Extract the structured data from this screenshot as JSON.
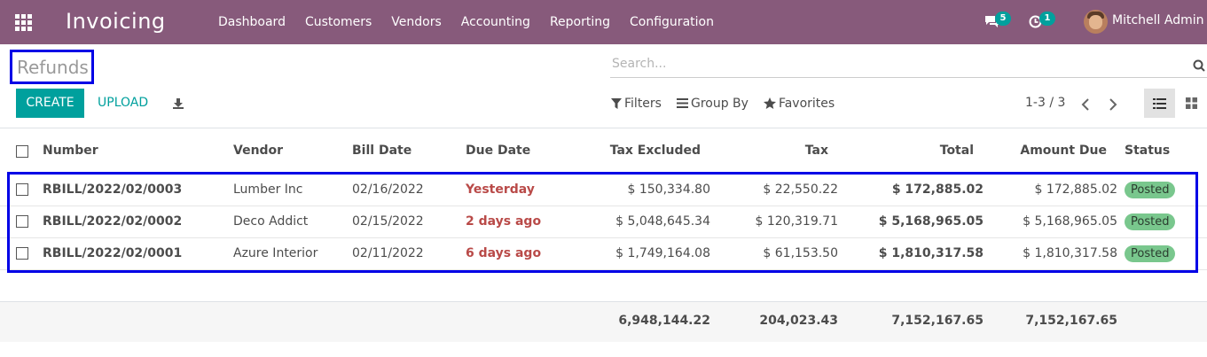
{
  "navbar": {
    "app_title": "Invoicing",
    "menu": [
      "Dashboard",
      "Customers",
      "Vendors",
      "Accounting",
      "Reporting",
      "Configuration"
    ],
    "messages_badge": "5",
    "activities_badge": "1",
    "user_name": "Mitchell Admin",
    "color": "#875a7b"
  },
  "breadcrumb": "Refunds",
  "search": {
    "placeholder": "Search..."
  },
  "toolbar": {
    "create_label": "CREATE",
    "upload_label": "UPLOAD"
  },
  "filters": {
    "filters_label": "Filters",
    "group_by_label": "Group By",
    "favorites_label": "Favorites"
  },
  "pager": "1-3 / 3",
  "table": {
    "columns": [
      "Number",
      "Vendor",
      "Bill Date",
      "Due Date",
      "Tax Excluded",
      "Tax",
      "Total",
      "Amount Due",
      "Status"
    ],
    "rows": [
      {
        "number": "RBILL/2022/02/0003",
        "vendor": "Lumber Inc",
        "bill_date": "02/16/2022",
        "due_date": "Yesterday",
        "tax_excluded": "$ 150,334.80",
        "tax": "$ 22,550.22",
        "total": "$ 172,885.02",
        "amount_due": "$ 172,885.02",
        "status": "Posted"
      },
      {
        "number": "RBILL/2022/02/0002",
        "vendor": "Deco Addict",
        "bill_date": "02/15/2022",
        "due_date": "2 days ago",
        "tax_excluded": "$ 5,048,645.34",
        "tax": "$ 120,319.71",
        "total": "$ 5,168,965.05",
        "amount_due": "$ 5,168,965.05",
        "status": "Posted"
      },
      {
        "number": "RBILL/2022/02/0001",
        "vendor": "Azure Interior",
        "bill_date": "02/11/2022",
        "due_date": "6 days ago",
        "tax_excluded": "$ 1,749,164.08",
        "tax": "$ 61,153.50",
        "total": "$ 1,810,317.58",
        "amount_due": "$ 1,810,317.58",
        "status": "Posted"
      }
    ],
    "totals": {
      "tax_excluded": "6,948,144.22",
      "tax": "204,023.43",
      "total": "7,152,167.65",
      "amount_due": "7,152,167.65"
    }
  },
  "colors": {
    "accent": "#00a09d",
    "overdue": "#b94a48",
    "status_posted": "#79c78d",
    "highlight_box": "#0000e6"
  }
}
